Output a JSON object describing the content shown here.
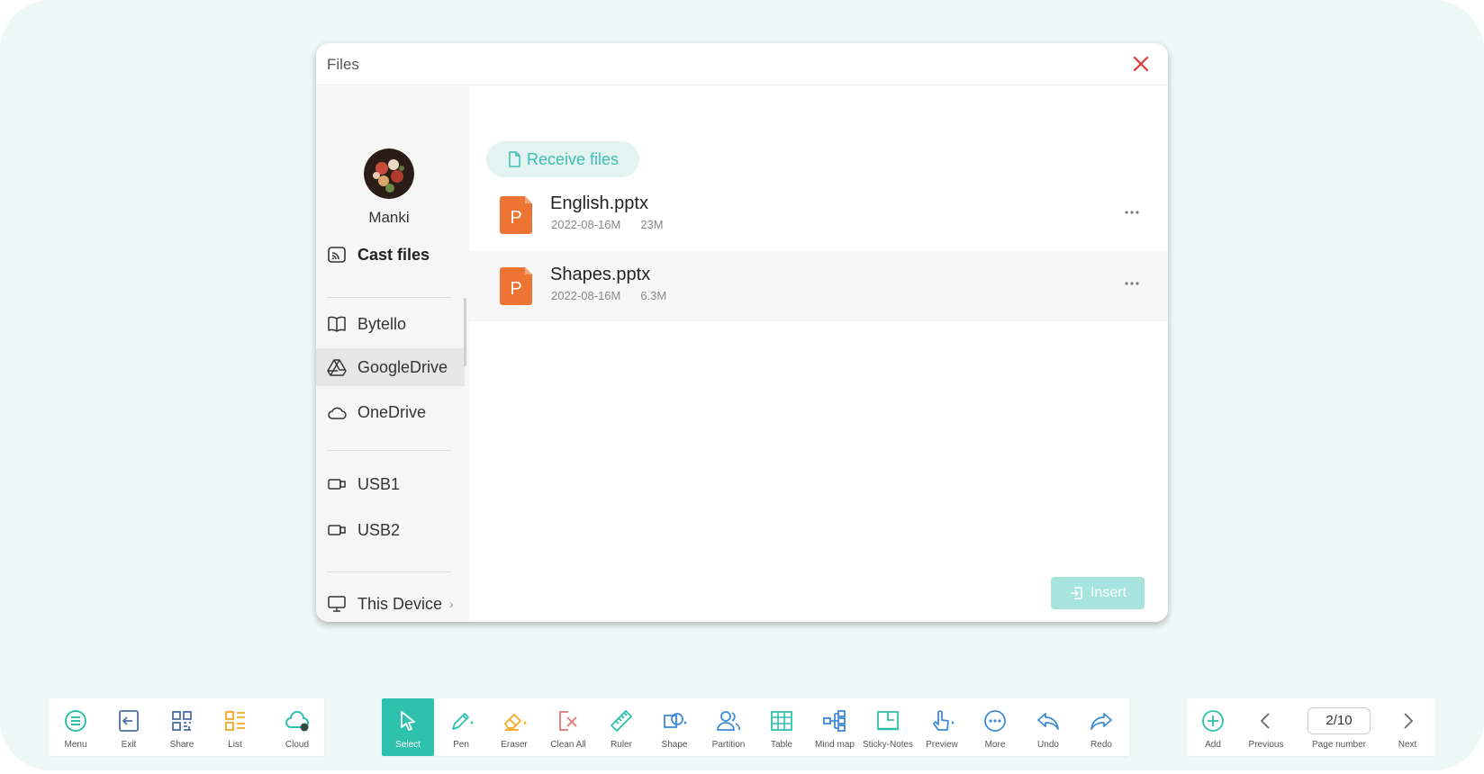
{
  "dialog": {
    "title": "Files",
    "user_name": "Manki",
    "cast_label": "Cast files",
    "nav": {
      "bytello": "Bytello",
      "googledrive": "GoogleDrive",
      "onedrive": "OneDrive",
      "usb1": "USB1",
      "usb2": "USB2",
      "this_device": "This Device"
    },
    "receive_label": "Receive files",
    "files": [
      {
        "name": "English.pptx",
        "date": "2022-08-16M",
        "size": "23M",
        "icon_letter": "P"
      },
      {
        "name": "Shapes.pptx",
        "date": "2022-08-16M",
        "size": "6.3M",
        "icon_letter": "P"
      }
    ],
    "insert_label": "Insert"
  },
  "toolbar_left": {
    "menu": "Menu",
    "exit": "Exit",
    "share": "Share",
    "list": "List",
    "cloud": "Cloud"
  },
  "toolbar_center": {
    "select": "Select",
    "pen": "Pen",
    "eraser": "Eraser",
    "clean_all": "Clean All",
    "ruler": "Ruler",
    "shape": "Shape",
    "partition": "Partition",
    "table": "Table",
    "mind_map": "Mind map",
    "sticky_notes": "Sticky-Notes",
    "preview": "Preview",
    "more": "More",
    "undo": "Undo",
    "redo": "Redo"
  },
  "toolbar_right": {
    "add": "Add",
    "previous": "Previous",
    "page_value": "2/10",
    "page_number": "Page number",
    "next": "Next"
  },
  "colors": {
    "accent": "#2ec1ad",
    "close": "#e53935",
    "pptx": "#ee7434",
    "list_icon": "#f5a623",
    "eraser_icon": "#f5a623",
    "clean_all_icon": "#e57373",
    "icon_blue": "#3d8bd6"
  }
}
